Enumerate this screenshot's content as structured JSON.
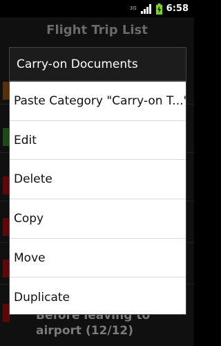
{
  "status_bar": {
    "network_tag": "3G",
    "sim_tag": "3G",
    "time": "6:58",
    "battery_color": "#7ed321"
  },
  "background": {
    "title": "Flight Trip List",
    "subtitle": "",
    "visible_item_text": "Before leaving to airport (12/12)",
    "marker_colors": [
      "#c06010",
      "#3a8a2a",
      "#aa1111",
      "#aa1111",
      "#aa1111",
      "#aa1111"
    ]
  },
  "dialog": {
    "title": "Carry-on Documents",
    "items": [
      "Paste Category \"Carry-on T...\"",
      "Edit",
      "Delete",
      "Copy",
      "Move",
      "Duplicate"
    ]
  }
}
